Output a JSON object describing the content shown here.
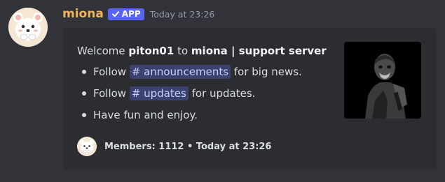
{
  "message": {
    "author": "miona",
    "badge": "APP",
    "timestamp": "Today at 23:26",
    "avatar_icon": "bear-avatar-icon"
  },
  "embed": {
    "welcome": {
      "prefix": "Welcome ",
      "user": "piton01",
      "middle": " to ",
      "server": "miona | support server"
    },
    "bullets": [
      {
        "prefix": "Follow ",
        "channel": "announcements",
        "suffix": " for big news."
      },
      {
        "prefix": "Follow ",
        "channel": "updates",
        "suffix": " for updates."
      },
      {
        "text": "Have fun and enjoy."
      }
    ],
    "footer": {
      "text": "Members: 1112 • Today at 23:26",
      "icon": "bear-avatar-icon"
    }
  },
  "colors": {
    "background": "#313338",
    "embed": "#2b2d31",
    "username": "#f0b35c",
    "badge": "#5865f2",
    "mention_bg": "#3c4270",
    "mention_text": "#c9cdfb"
  }
}
